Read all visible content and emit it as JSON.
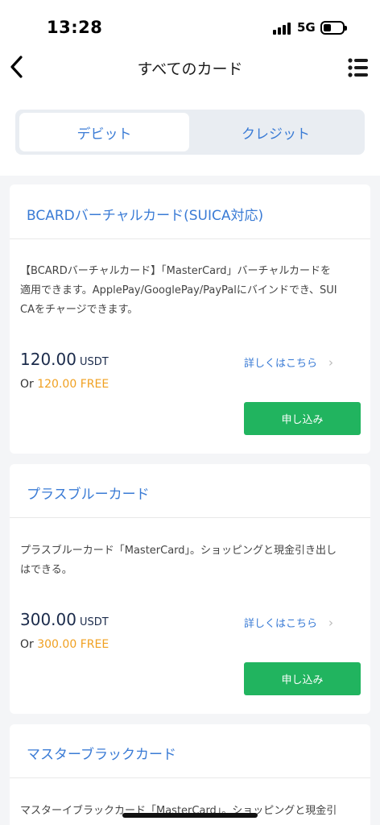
{
  "status_bar": {
    "time": "13:28",
    "network": "5G"
  },
  "nav": {
    "title": "すべてのカード"
  },
  "tabs": [
    {
      "label": "デビット",
      "active": true
    },
    {
      "label": "クレジット",
      "active": false
    }
  ],
  "cards": [
    {
      "title": "BCARDバーチャルカード(SUICA対応)",
      "description_lines": [
        "【BCARDバーチャルカード】「MasterCard」バーチャルカードを",
        "適用できます。ApplePay/GooglePay/PayPalにバインドでき、SUI",
        "CAをチャージできます。"
      ],
      "price": "120.00",
      "currency": "USDT",
      "alt_prefix": "Or",
      "alt_price": "120.00",
      "alt_label": "FREE",
      "details_label": "詳しくはこちら",
      "apply_label": "申し込み"
    },
    {
      "title": "プラスブルーカード",
      "description_lines": [
        "プラスブルーカード「MasterCard」。ショッピングと現金引き出し",
        "はできる。"
      ],
      "price": "300.00",
      "currency": "USDT",
      "alt_prefix": "Or",
      "alt_price": "300.00",
      "alt_label": "FREE",
      "details_label": "詳しくはこちら",
      "apply_label": "申し込み"
    },
    {
      "title": "マスターブラックカード",
      "description_lines": [
        "マスターイブラックカード「MasterCard」。ショッピングと現金引"
      ]
    }
  ],
  "colors": {
    "accent": "#3a7bd5",
    "apply_button": "#21b45f",
    "free_price": "#f0a020",
    "background": "#f4f5f7"
  },
  "icons": {
    "back": "chevron-left-icon",
    "menu": "list-menu-icon",
    "details": "chevron-right-icon"
  }
}
